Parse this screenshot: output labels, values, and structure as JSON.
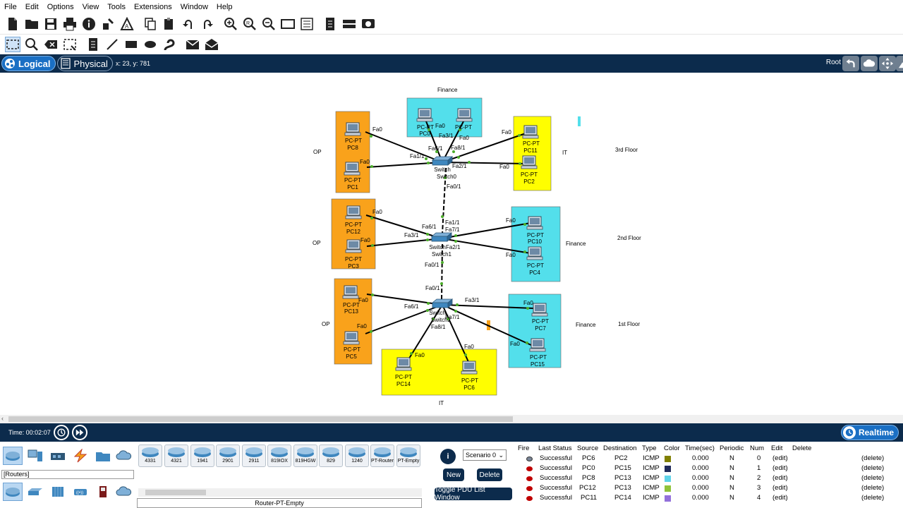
{
  "menu": [
    "File",
    "Edit",
    "Options",
    "View",
    "Tools",
    "Extensions",
    "Window",
    "Help"
  ],
  "nav": {
    "logical_label": "Logical",
    "physical_label": "Physical",
    "coords": "x: 23, y: 781",
    "root_label": "Root"
  },
  "workspace": {
    "areas": [
      {
        "label": "Finance",
        "color": "#53dfeb"
      },
      {
        "label": "OP",
        "color": "#f9a21b"
      },
      {
        "label": "IT",
        "color": "#fffe00"
      }
    ],
    "floor_labels": [
      "3rd Floor",
      "2nd Floor",
      "1st Floor"
    ],
    "side_labels": {
      "op3": "OP",
      "it3": "IT",
      "op2": "OP",
      "fin2": "Finance",
      "op1": "OP",
      "fin1": "Finance",
      "fin3": "Finance",
      "it1": "IT"
    },
    "switches": [
      {
        "label": "Switch0",
        "model": "Switch"
      },
      {
        "label": "Switch1",
        "model": "Switch"
      },
      {
        "label": "Switch2",
        "model": "Switch"
      }
    ],
    "pcs": [
      {
        "name": "PC0",
        "type": "PC-PT"
      },
      {
        "name": "PC9",
        "type": "PC-PT"
      },
      {
        "name": "PC8",
        "type": "PC-PT"
      },
      {
        "name": "PC1",
        "type": "PC-PT"
      },
      {
        "name": "PC11",
        "type": "PC-PT"
      },
      {
        "name": "PC2",
        "type": "PC-PT"
      },
      {
        "name": "PC12",
        "type": "PC-PT"
      },
      {
        "name": "PC3",
        "type": "PC-PT"
      },
      {
        "name": "PC10",
        "type": "PC-PT"
      },
      {
        "name": "PC4",
        "type": "PC-PT"
      },
      {
        "name": "PC13",
        "type": "PC-PT"
      },
      {
        "name": "PC5",
        "type": "PC-PT"
      },
      {
        "name": "PC7",
        "type": "PC-PT"
      },
      {
        "name": "PC15",
        "type": "PC-PT"
      },
      {
        "name": "PC14",
        "type": "PC-PT"
      },
      {
        "name": "PC6",
        "type": "PC-PT"
      }
    ],
    "ports": [
      "Fa0",
      "Fa3/1",
      "Fa6/1",
      "Fa8/1",
      "Fa1/1",
      "Fa2/1",
      "Fa0/1",
      "Fa7/1"
    ]
  },
  "timebar": {
    "time_label": "Time: 00:02:07",
    "realtime_label": "Realtime"
  },
  "device_panel": {
    "category_label": "[Routers]",
    "devices": [
      "4331",
      "4321",
      "1941",
      "2901",
      "2911",
      "819IOX",
      "819HGW",
      "829",
      "1240",
      "PT-Router",
      "PT-Empty"
    ],
    "selected_device": "Router-PT-Empty"
  },
  "scenario": {
    "selected": "Scenario 0",
    "new_label": "New",
    "delete_label": "Delete",
    "toggle_label": "Toggle PDU List Window"
  },
  "pdu_table": {
    "headers": [
      "Fire",
      "Last Status",
      "Source",
      "Destination",
      "Type",
      "Color",
      "Time(sec)",
      "Periodic",
      "Num",
      "Edit",
      "Delete"
    ],
    "rows": [
      {
        "status": "Successful",
        "source": "PC6",
        "destination": "PC2",
        "type": "ICMP",
        "color": "#808000",
        "time": "0.000",
        "periodic": "N",
        "num": "0",
        "edit": "(edit)",
        "delete": "(delete)"
      },
      {
        "status": "Successful",
        "source": "PC0",
        "destination": "PC15",
        "type": "ICMP",
        "color": "#1f2a5a",
        "time": "0.000",
        "periodic": "N",
        "num": "1",
        "edit": "(edit)",
        "delete": "(delete)"
      },
      {
        "status": "Successful",
        "source": "PC8",
        "destination": "PC13",
        "type": "ICMP",
        "color": "#5fd3e8",
        "time": "0.000",
        "periodic": "N",
        "num": "2",
        "edit": "(edit)",
        "delete": "(delete)"
      },
      {
        "status": "Successful",
        "source": "PC12",
        "destination": "PC13",
        "type": "ICMP",
        "color": "#8fc23a",
        "time": "0.000",
        "periodic": "N",
        "num": "3",
        "edit": "(edit)",
        "delete": "(delete)"
      },
      {
        "status": "Successful",
        "source": "PC11",
        "destination": "PC14",
        "type": "ICMP",
        "color": "#9370db",
        "time": "0.000",
        "periodic": "N",
        "num": "4",
        "edit": "(edit)",
        "delete": "(delete)"
      }
    ]
  }
}
